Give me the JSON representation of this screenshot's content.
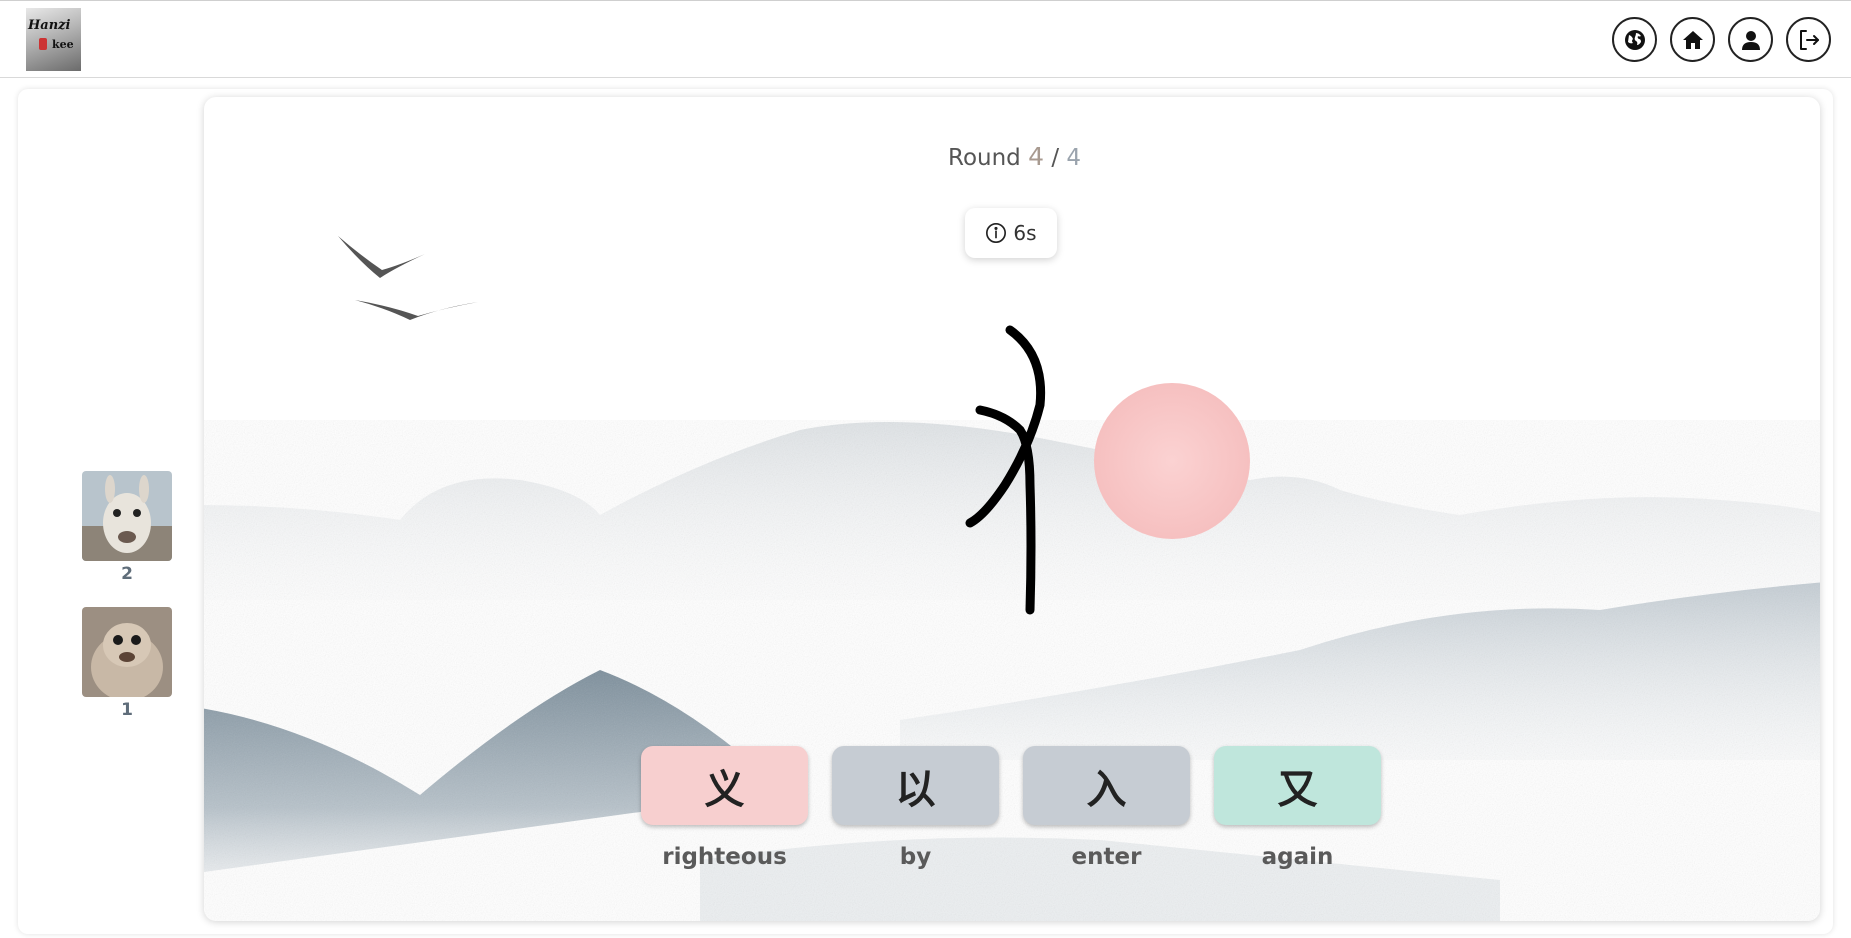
{
  "app": {
    "logo_text_top": "Hanzi",
    "logo_text_bottom": "kee"
  },
  "nav": {
    "buttons": [
      {
        "name": "language",
        "icon": "globe-icon"
      },
      {
        "name": "home",
        "icon": "home-icon"
      },
      {
        "name": "profile",
        "icon": "user-icon"
      },
      {
        "name": "logout",
        "icon": "logout-icon"
      }
    ]
  },
  "players": [
    {
      "avatar": "llama",
      "score": "2"
    },
    {
      "avatar": "seal",
      "score": "1"
    }
  ],
  "game": {
    "round_label": "Round",
    "round_current": "4",
    "round_separator": "/",
    "round_total": "4",
    "timer_icon": "info-icon",
    "timer_text": "6s",
    "answers": [
      {
        "char": "义",
        "meaning": "righteous",
        "color": "#f7cfcf"
      },
      {
        "char": "以",
        "meaning": "by",
        "color": "#c6ccd3"
      },
      {
        "char": "入",
        "meaning": "enter",
        "color": "#c6ccd3"
      },
      {
        "char": "又",
        "meaning": "again",
        "color": "#bfe6dc"
      }
    ]
  },
  "colors": {
    "wrong": "#f7cfcf",
    "neutral": "#c6ccd3",
    "correct": "#bfe6dc",
    "sun": "#f8c5c5"
  }
}
